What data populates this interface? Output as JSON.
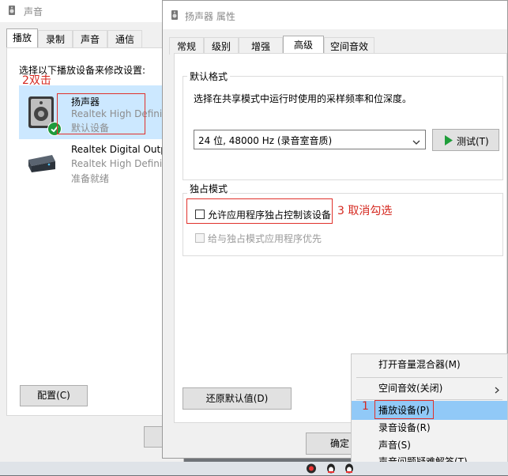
{
  "sound_window": {
    "title": "声音",
    "tabs": [
      "播放",
      "录制",
      "声音",
      "通信"
    ],
    "instruction": "选择以下播放设备来修改设置:",
    "devices": [
      {
        "name": "扬声器",
        "driver": "Realtek High Definiti",
        "status": "默认设备"
      },
      {
        "name": "Realtek Digital Outp",
        "driver": "Realtek High Definiti",
        "status": "准备就绪"
      }
    ],
    "configure_button": "配置(C)"
  },
  "props_window": {
    "title": "扬声器 属性",
    "tabs": [
      "常规",
      "级别",
      "增强",
      "高级",
      "空间音效"
    ],
    "active_tab": "高级",
    "default_format": {
      "group_label": "默认格式",
      "description": "选择在共享模式中运行时使用的采样频率和位深度。",
      "selected": "24 位, 48000 Hz (录音室音质)",
      "test_button": "测试(T)"
    },
    "exclusive_mode": {
      "group_label": "独占模式",
      "allow_exclusive": "允许应用程序独占控制该设备",
      "priority": "给与独占模式应用程序优先"
    },
    "restore_button": "还原默认值(D)",
    "ok_button": "确定"
  },
  "context_menu": {
    "items": [
      {
        "label": "打开音量混合器(M)"
      },
      {
        "label": "空间音效(关闭)"
      },
      {
        "label": "播放设备(P)"
      },
      {
        "label": "录音设备(R)"
      },
      {
        "label": "声音(S)"
      },
      {
        "label": "声音问题疑难解答(T)"
      }
    ]
  },
  "annotations": {
    "step1": "1",
    "step2": "2双击",
    "step3": "3 取消勾选"
  },
  "colors": {
    "highlight": "#cce8ff",
    "menu_highlight": "#91c9f7",
    "annotation_red": "#e0312b",
    "check_green": "#1e9b3c",
    "play_green": "#1f9e3a"
  }
}
